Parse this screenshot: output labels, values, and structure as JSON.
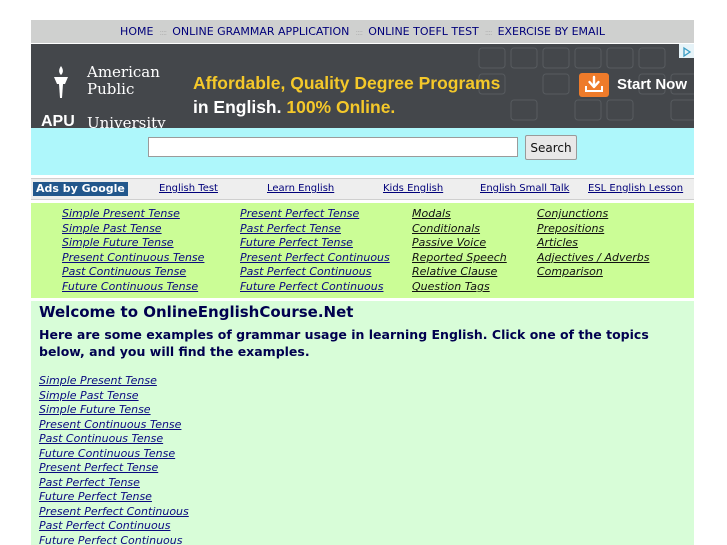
{
  "nav": {
    "items": [
      "HOME",
      "ONLINE GRAMMAR APPLICATION",
      "ONLINE TOEFL TEST",
      "EXERCISE BY EMAIL"
    ],
    "separator": "::::"
  },
  "banner": {
    "logo_line1": "American",
    "logo_line2": "Public",
    "logo_acronym": "APU",
    "logo_line3": "University",
    "headline_line1": "Affordable, Quality Degree Programs",
    "headline_line2a": "in English.",
    "headline_line2b": "100% Online.",
    "cta_label": "Start Now",
    "cta_icon": "download-arrow-icon",
    "background_color": "#44474b",
    "accent_color": "#f4c82a",
    "cta_color": "#ee7b2a"
  },
  "search": {
    "value": "",
    "button_label": "Search"
  },
  "adlinks": {
    "ads_by": "Ads by Google",
    "links": [
      "English Test",
      "Learn English",
      "Kids English",
      "English Small Talk",
      "ESL English Lesson"
    ]
  },
  "topics": {
    "col1": [
      "Simple Present Tense",
      "Simple Past Tense",
      "Simple Future Tense",
      "Present Continuous Tense",
      "Past Continuous Tense",
      "Future Continuous Tense"
    ],
    "col2": [
      "Present Perfect Tense",
      "Past Perfect Tense",
      "Future Perfect Tense",
      "Present Perfect Continuous",
      "Past Perfect Continuous",
      "Future Perfect Continuous"
    ],
    "col3": [
      "Modals",
      "Conditionals",
      "Passive Voice",
      "Reported Speech",
      "Relative Clause",
      "Question Tags"
    ],
    "col4": [
      "Conjunctions",
      "Prepositions",
      "Articles",
      "Adjectives / Adverbs",
      "Comparison"
    ]
  },
  "main": {
    "title": "Welcome to OnlineEnglishCourse.Net",
    "intro": "Here are some examples of grammar usage in learning English. Click one of the topics below, and you will find the examples.",
    "examples": [
      "Simple Present Tense",
      "Simple Past Tense",
      "Simple Future Tense",
      "Present Continuous Tense",
      "Past Continuous Tense",
      "Future Continuous Tense",
      "Present Perfect Tense",
      "Past Perfect Tense",
      "Future Perfect Tense",
      "Present Perfect Continuous",
      "Past Perfect Continuous",
      "Future Perfect Continuous"
    ]
  },
  "colors": {
    "nav_bg": "#cfd0cf",
    "search_bg": "#aef7fb",
    "topics_bg": "#cbfd96",
    "main_bg": "#d8fdd8",
    "link": "#0a0a80"
  }
}
